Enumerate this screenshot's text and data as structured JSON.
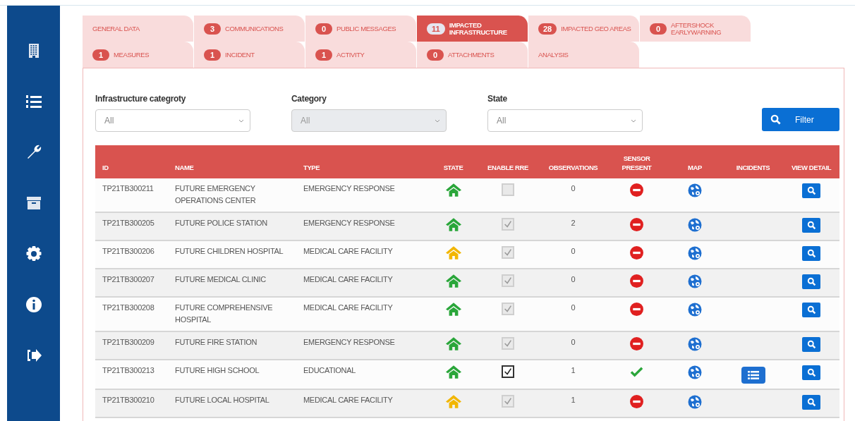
{
  "sidebar": {
    "items": [
      {
        "kind": "building"
      },
      {
        "kind": "list"
      },
      {
        "kind": "wrench"
      },
      {
        "kind": "archive"
      },
      {
        "kind": "gear"
      },
      {
        "kind": "info"
      },
      {
        "kind": "logout"
      }
    ]
  },
  "tabs": [
    [
      {
        "label": "GENERAL DATA",
        "selected": false
      },
      {
        "label": "COMMUNICATIONS",
        "count": "3",
        "selected": false
      },
      {
        "label": "PUBLIC MESSAGES",
        "count": "0",
        "selected": false
      },
      {
        "label": "IMPACTED INFRASTRUCTURE",
        "count": "11",
        "selected": true
      },
      {
        "label": "IMPACTED GEO AREAS",
        "count": "28",
        "selected": false
      },
      {
        "label": "AFTERSHOCK EARLYWARNING",
        "count": "0",
        "selected": false
      }
    ],
    [
      {
        "label": "MEASURES",
        "count": "1",
        "selected": false
      },
      {
        "label": "INCIDENT",
        "count": "1",
        "selected": false
      },
      {
        "label": "ACTIVITY",
        "count": "1",
        "selected": false
      },
      {
        "label": "ATTACHMENTS",
        "count": "0",
        "selected": false
      },
      {
        "label": "ANALYSIS",
        "selected": false
      }
    ]
  ],
  "filters": [
    {
      "label": "Infrastructure categroty",
      "value": "All",
      "disabled": false
    },
    {
      "label": "Category",
      "value": "All",
      "disabled": true
    },
    {
      "label": "State",
      "value": "All",
      "disabled": false
    }
  ],
  "filter_button": "Filter",
  "table": {
    "columns": [
      "ID",
      "NAME",
      "TYPE",
      "STATE",
      "ENABLE RRE",
      "OBSERVATIONS",
      "SENSOR PRESENT",
      "MAP",
      "INCIDENTS",
      "VIEW DETAIL"
    ],
    "rows": [
      {
        "id": "TP21TB300211",
        "name": "FUTURE EMERGENCY OPERATIONS CENTER",
        "type": "EMERGENCY RESPONSE",
        "color": "#2aa63a",
        "enable_rre": false,
        "rre_disabled": true,
        "observations": "0",
        "sensor_present": false,
        "has_incidents": false
      },
      {
        "id": "TP21TB300205",
        "name": "FUTURE POLICE STATION",
        "type": "EMERGENCY RESPONSE",
        "color": "#2aa63a",
        "enable_rre": true,
        "rre_disabled": true,
        "observations": "2",
        "sensor_present": false,
        "has_incidents": false
      },
      {
        "id": "TP21TB300206",
        "name": "FUTURE CHILDREN HOSPITAL",
        "type": "MEDICAL CARE FACILITY",
        "color": "#f2b600",
        "enable_rre": true,
        "rre_disabled": true,
        "observations": "0",
        "sensor_present": false,
        "has_incidents": false
      },
      {
        "id": "TP21TB300207",
        "name": "FUTURE MEDICAL CLINIC",
        "type": "MEDICAL CARE FACILITY",
        "color": "#2aa63a",
        "enable_rre": true,
        "rre_disabled": true,
        "observations": "0",
        "sensor_present": false,
        "has_incidents": false
      },
      {
        "id": "TP21TB300208",
        "name": "FUTURE COMPREHENSIVE HOSPITAL",
        "type": "MEDICAL CARE FACILITY",
        "color": "#2aa63a",
        "enable_rre": true,
        "rre_disabled": true,
        "observations": "0",
        "sensor_present": false,
        "has_incidents": false
      },
      {
        "id": "TP21TB300209",
        "name": "FUTURE FIRE STATION",
        "type": "EMERGENCY RESPONSE",
        "color": "#2aa63a",
        "enable_rre": true,
        "rre_disabled": true,
        "observations": "0",
        "sensor_present": false,
        "has_incidents": false
      },
      {
        "id": "TP21TB300213",
        "name": "FUTURE HIGH SCHOOL",
        "type": "EDUCATIONAL",
        "color": "#2aa63a",
        "enable_rre": true,
        "rre_disabled": false,
        "observations": "1",
        "sensor_present": true,
        "has_incidents": true
      },
      {
        "id": "TP21TB300210",
        "name": "FUTURE LOCAL HOSPITAL",
        "type": "MEDICAL CARE FACILITY",
        "color": "#f2b600",
        "enable_rre": true,
        "rre_disabled": true,
        "observations": "1",
        "sensor_present": false,
        "has_incidents": false
      }
    ]
  }
}
